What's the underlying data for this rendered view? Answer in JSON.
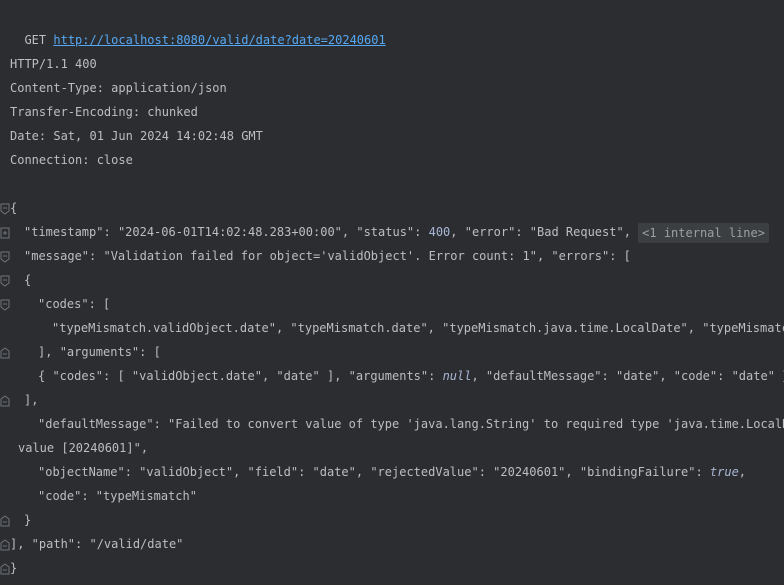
{
  "request": {
    "method": "GET",
    "url": "http://localhost:8080/valid/date?date=20240601"
  },
  "response_headers": [
    "HTTP/1.1 400",
    "Content-Type: application/json",
    "Transfer-Encoding: chunked",
    "Date: Sat, 01 Jun 2024 14:02:48 GMT",
    "Connection: close"
  ],
  "json": {
    "timestamp_key": "\"timestamp\"",
    "timestamp_val": "\"2024-06-01T14:02:48.283+00:00\"",
    "status_key": "\"status\"",
    "status_val": "400",
    "error_key": "\"error\"",
    "error_val": "\"Bad Request\"",
    "internal_line": "<1 internal line>",
    "message_key": "\"message\"",
    "message_val": "\"Validation failed for object='validObject'. Error count: 1\"",
    "errors_key": "\"errors\"",
    "codes_key": "\"codes\"",
    "codes_line": "\"typeMismatch.validObject.date\", \"typeMismatch.date\", \"typeMismatch.java.time.LocalDate\", \"typeMismatch\"",
    "arguments_key": "\"arguments\"",
    "arg_codes_line": "{ \"codes\": [ \"validObject.date\", \"date\" ], \"arguments\": ",
    "arg_null": "null",
    "arg_rest": ", \"defaultMessage\": \"date\", \"code\": \"date\" }",
    "default_message_line": "\"defaultMessage\": \"Failed to convert value of type 'java.lang.String' to required type 'java.time.LocalDate",
    "default_message_cont": "value [20240601]\",",
    "object_line_start": "\"objectName\": \"validObject\", \"field\": \"date\", \"rejectedValue\": \"20240601\", \"bindingFailure\": ",
    "true_val": "true",
    "code_line": "\"code\": \"typeMismatch\"",
    "path_line": "], \"path\": \"/valid/date\""
  }
}
